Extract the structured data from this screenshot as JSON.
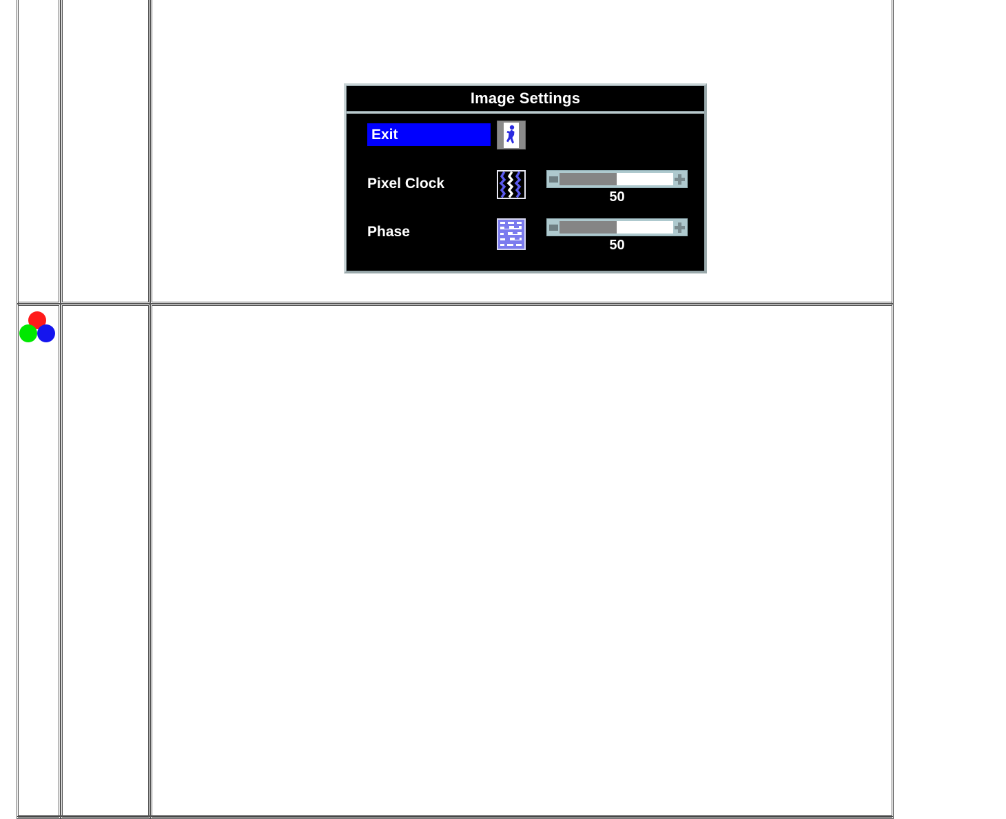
{
  "document": {
    "sidebar_icon": "rgb-circles-icon",
    "rgb_colors": {
      "red": "#ff1a1a",
      "green": "#00e800",
      "blue": "#1515ee"
    }
  },
  "osd": {
    "title": "Image Settings",
    "highlight_color": "#0000ff",
    "background_color": "#000000",
    "text_color": "#ffffff",
    "slider_frame_color": "#aec9ce",
    "slider_fill_color": "#858585",
    "rows": [
      {
        "label": "Exit",
        "icon": "exit-door-icon",
        "selected": true,
        "has_slider": false,
        "value": ""
      },
      {
        "label": "Pixel Clock",
        "icon": "pixel-clock-waves-icon",
        "selected": false,
        "has_slider": true,
        "value": "50",
        "percent": 50,
        "minus_label": "-",
        "plus_label": "+"
      },
      {
        "label": "Phase",
        "icon": "phase-pattern-icon",
        "selected": false,
        "has_slider": true,
        "value": "50",
        "percent": 50,
        "minus_label": "-",
        "plus_label": "+"
      }
    ]
  }
}
